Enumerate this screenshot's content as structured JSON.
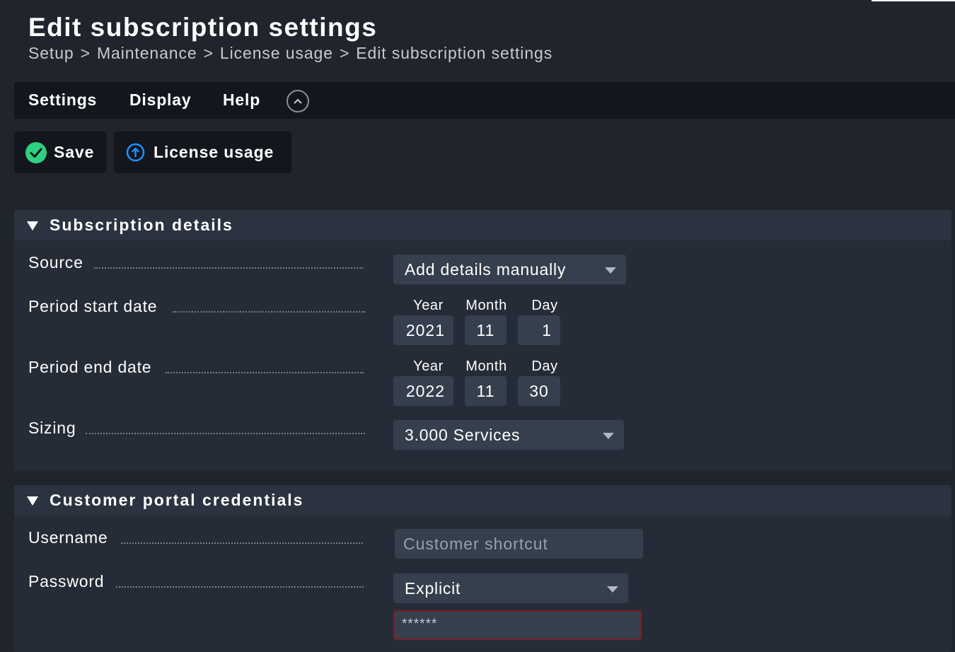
{
  "page": {
    "title": "Edit subscription settings",
    "breadcrumb": [
      "Setup",
      "Maintenance",
      "License usage",
      "Edit subscription settings"
    ],
    "breadcrumb_separator": ">"
  },
  "menubar": {
    "items": [
      "Settings",
      "Display",
      "Help"
    ],
    "toggle_icon": "chevron-up-icon"
  },
  "toolbar": {
    "save_label": "Save",
    "save_icon": "check-circle-icon",
    "license_usage_label": "License usage",
    "license_usage_icon": "arrow-up-circle-icon"
  },
  "subscription_details": {
    "title": "Subscription details",
    "source": {
      "label": "Source",
      "value": "Add details manually"
    },
    "period_start": {
      "label": "Period start date",
      "year_label": "Year",
      "month_label": "Month",
      "day_label": "Day",
      "year": "2021",
      "month": "11",
      "day": "1"
    },
    "period_end": {
      "label": "Period end date",
      "year_label": "Year",
      "month_label": "Month",
      "day_label": "Day",
      "year": "2022",
      "month": "11",
      "day": "30"
    },
    "sizing": {
      "label": "Sizing",
      "value": "3.000 Services"
    }
  },
  "customer_portal": {
    "title": "Customer portal credentials",
    "username": {
      "label": "Username",
      "placeholder": "Customer shortcut",
      "value": ""
    },
    "password": {
      "label": "Password",
      "mode": "Explicit",
      "masked_value": "******"
    }
  },
  "colors": {
    "background": "#1f242d",
    "menubar": "#13171d",
    "section_header": "#2b3340",
    "section_body": "#262c37",
    "field": "#353f4d",
    "save_icon": "#2fd07f",
    "info_icon": "#1e90ff",
    "error_border": "#7a1f28"
  }
}
